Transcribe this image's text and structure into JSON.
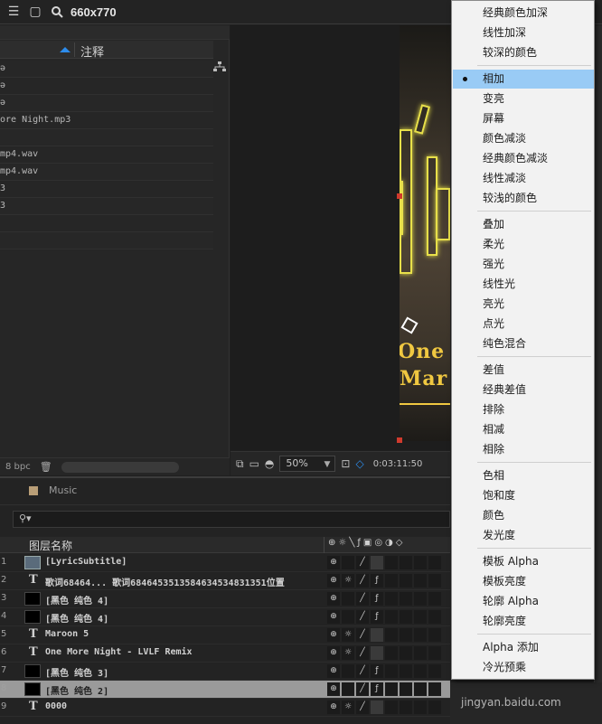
{
  "window": {
    "title": "660x770"
  },
  "project": {
    "header": {
      "comment_col": "注释"
    },
    "rows": [
      "ə",
      "ə",
      "ə",
      "ore Night.mp3",
      "",
      "mp4.wav",
      "mp4.wav",
      "3",
      "3",
      "",
      ""
    ],
    "footer": {
      "bpc": "8 bpc"
    }
  },
  "viewer": {
    "zoom": "50%",
    "timecode": "0:03:11:50",
    "caption_line1": "One",
    "caption_line2": "Mar"
  },
  "timeline": {
    "comp_tab": "Music",
    "layer_col_header": "图层名称",
    "layers": [
      {
        "num": "1",
        "kind": "comp",
        "name": "[LyricSubtitle]"
      },
      {
        "num": "2",
        "kind": "text",
        "name": "歌词68464... 歌词68464535135846345348313​51位置"
      },
      {
        "num": "3",
        "kind": "solid",
        "name": "[黑色 纯色 4]"
      },
      {
        "num": "4",
        "kind": "solid",
        "name": "[黑色 纯色 4]"
      },
      {
        "num": "5",
        "kind": "text",
        "name": "Maroon 5"
      },
      {
        "num": "6",
        "kind": "text",
        "name": "One More Night - LVLF Remix"
      },
      {
        "num": "7",
        "kind": "solid",
        "name": "[黑色 纯色 3]"
      },
      {
        "num": "8",
        "kind": "solid",
        "name": "[黑色 纯色 2]"
      },
      {
        "num": "9",
        "kind": "text",
        "name": "0000"
      }
    ]
  },
  "blend_menu": {
    "selected": "相加",
    "items": [
      "经典颜色加深",
      "线性加深",
      "较深的颜色",
      "相加",
      "变亮",
      "屏幕",
      "颜色减淡",
      "经典颜色减淡",
      "线性减淡",
      "较浅的颜色",
      "叠加",
      "柔光",
      "强光",
      "线性光",
      "亮光",
      "点光",
      "纯色混合",
      "差值",
      "经典差值",
      "排除",
      "相减",
      "相除",
      "色相",
      "饱和度",
      "颜色",
      "发光度",
      "模板 Alpha",
      "模板亮度",
      "轮廓 Alpha",
      "轮廓亮度",
      "Alpha 添加",
      "冷光预乘"
    ]
  },
  "watermark": "jingyan.baidu.com"
}
